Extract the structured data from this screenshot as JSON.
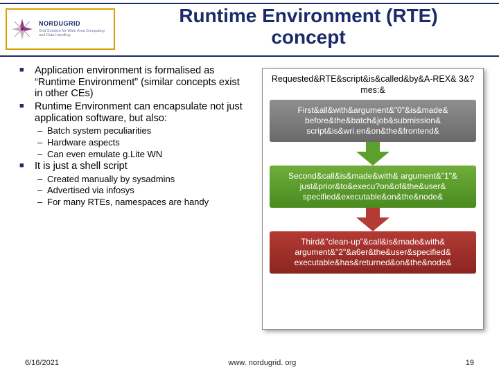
{
  "logo": {
    "brand": "NORDUGRID",
    "tagline": "Grid Solution for Wide Area Computing and Data Handling"
  },
  "title_line1": "Runtime Environment (RTE)",
  "title_line2": "concept",
  "bullets": {
    "b1": "Application environment is formalised as “Runtime Environment” (similar concepts exist in other CEs)",
    "b2": "Runtime Environment can encapsulate not just application software, but also:",
    "b2_sub": [
      "Batch system peculiarities",
      "Hardware aspects",
      "Can even emulate g.Lite WN"
    ],
    "b3": "It is just a shell script",
    "b3_sub": [
      "Created manually by sysadmins",
      "Advertised via infosys",
      "For many RTEs, namespaces are handy"
    ]
  },
  "diagram": {
    "top": "Requested&RTE&script&is&called&by&A-REX& 3&?mes:&",
    "box1": "First&all&with&argument&\"0\"&is&made& before&the&batch&job&submission& script&is&wri.en&on&the&frontend&",
    "box2": "Second&call&is&made&with& argument&\"1\"& just&prior&to&execu?on&of&the&user& specified&executable&on&the&node&",
    "box3": "Third&\"clean-up\"&call&is&made&with& argument&\"2\"&a6er&the&user&specified& executable&has&returned&on&the&node&"
  },
  "footer": {
    "date": "6/16/2021",
    "url": "www. nordugrid. org",
    "page": "19"
  }
}
